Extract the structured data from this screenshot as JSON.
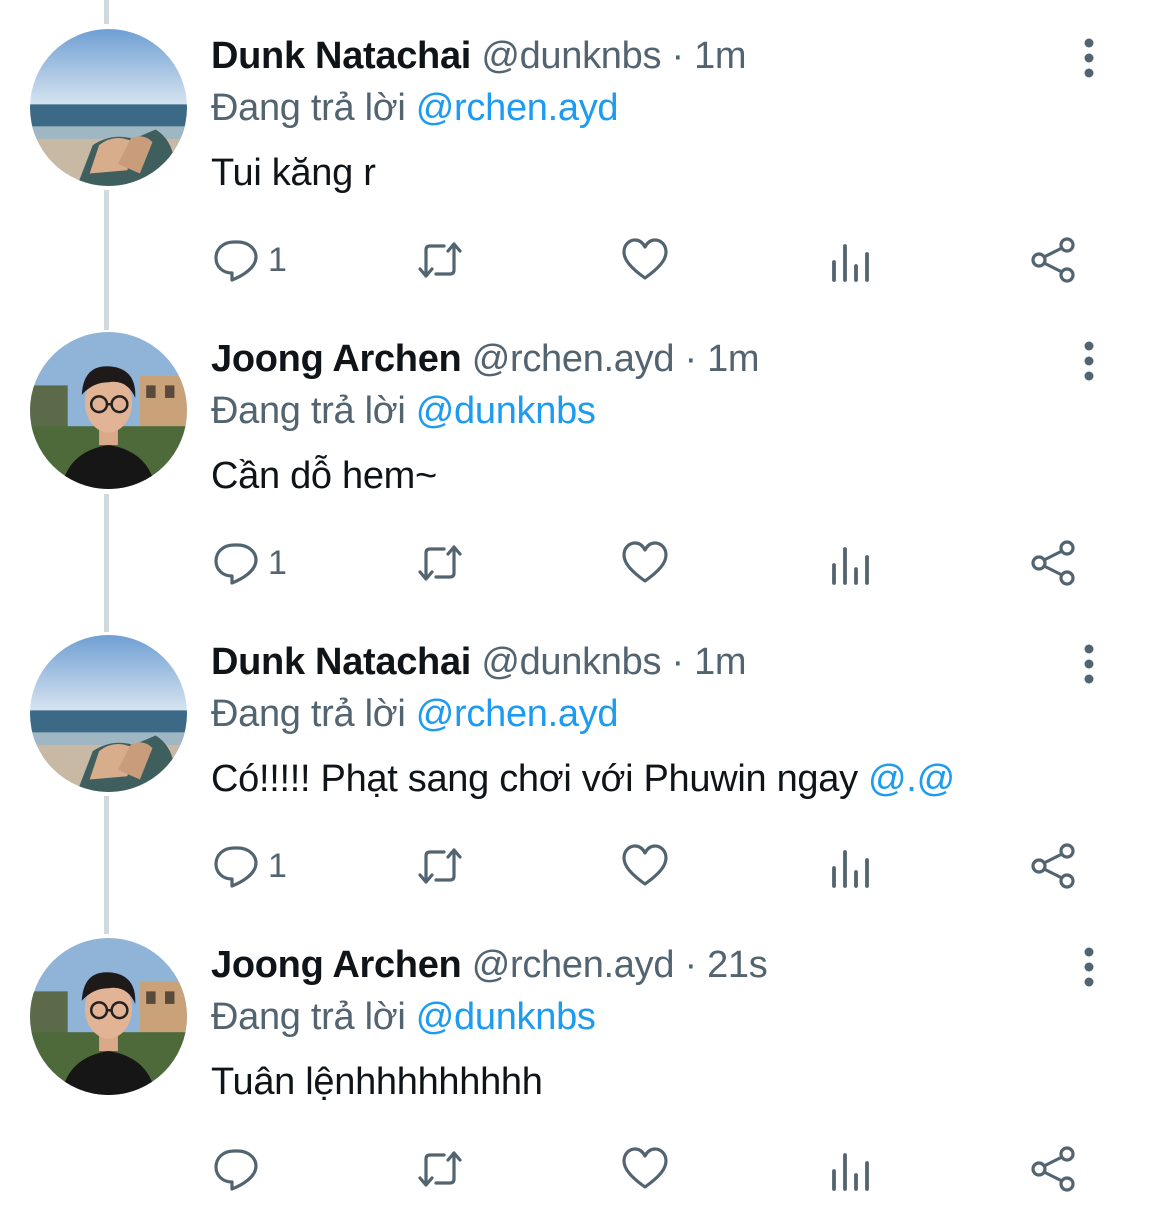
{
  "tweets": [
    {
      "name": "Dunk Natachai",
      "handle": "@dunknbs",
      "sep": "·",
      "time": "1m",
      "replying_prefix": "Đang trả lời",
      "replying_to": "@rchen.ayd",
      "text": "Tui kăng r",
      "text_mention": "",
      "reply_count": "1",
      "avatar": "sea-hands-photo"
    },
    {
      "name": "Joong Archen",
      "handle": "@rchen.ayd",
      "sep": "·",
      "time": "1m",
      "replying_prefix": "Đang trả lời",
      "replying_to": "@dunknbs",
      "text": "Cần dỗ hem~",
      "text_mention": "",
      "reply_count": "1",
      "avatar": "man-glasses-photo"
    },
    {
      "name": "Dunk Natachai",
      "handle": "@dunknbs",
      "sep": "·",
      "time": "1m",
      "replying_prefix": "Đang trả lời",
      "replying_to": "@rchen.ayd",
      "text": "Có!!!!! Phạt sang chơi với Phuwin ngay ",
      "text_mention": "@.@",
      "reply_count": "1",
      "avatar": "sea-hands-photo"
    },
    {
      "name": "Joong Archen",
      "handle": "@rchen.ayd",
      "sep": "·",
      "time": "21s",
      "replying_prefix": "Đang trả lời",
      "replying_to": "@dunknbs",
      "text": "Tuân lệnhhhhhhhhh",
      "text_mention": "",
      "reply_count": "",
      "avatar": "man-glasses-photo"
    }
  ],
  "icons": {
    "reply": "reply-icon",
    "retweet": "retweet-icon",
    "like": "like-icon",
    "views": "views-icon",
    "share": "share-icon",
    "more": "more-icon"
  },
  "colors": {
    "text": "#0f1419",
    "muted": "#536471",
    "accent": "#1d9bf0",
    "thread_line": "#cfd9de"
  }
}
